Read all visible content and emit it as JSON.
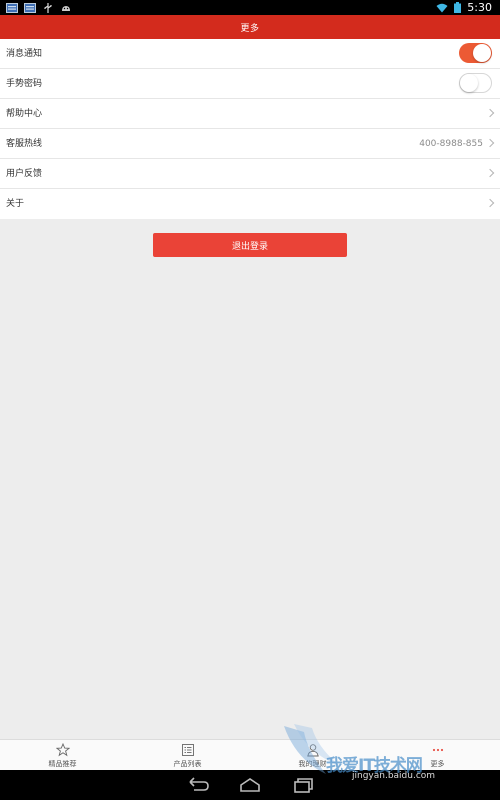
{
  "status_bar": {
    "time": "5:30"
  },
  "header": {
    "title": "更多"
  },
  "settings": {
    "items": [
      {
        "label": "消息通知",
        "control": "toggle",
        "on": true
      },
      {
        "label": "手势密码",
        "control": "toggle",
        "on": false
      },
      {
        "label": "帮助中心",
        "control": "chevron"
      },
      {
        "label": "客服热线",
        "value": "400-8988-855",
        "control": "chevron"
      },
      {
        "label": "用户反馈",
        "control": "chevron"
      },
      {
        "label": "关于",
        "control": "chevron"
      }
    ]
  },
  "logout": {
    "label": "退出登录"
  },
  "tabs": [
    {
      "label": "精品推荐",
      "icon": "star-icon"
    },
    {
      "label": "产品列表",
      "icon": "list-icon"
    },
    {
      "label": "我的理财",
      "icon": "user-icon"
    },
    {
      "label": "更多",
      "icon": "more-icon"
    }
  ],
  "watermark": {
    "title": "我爱IT技术网",
    "url": "jingyan.baidu.com"
  },
  "colors": {
    "accent": "#d32b1d",
    "toggle_on": "#ec5a34",
    "logout": "#ea4337"
  }
}
